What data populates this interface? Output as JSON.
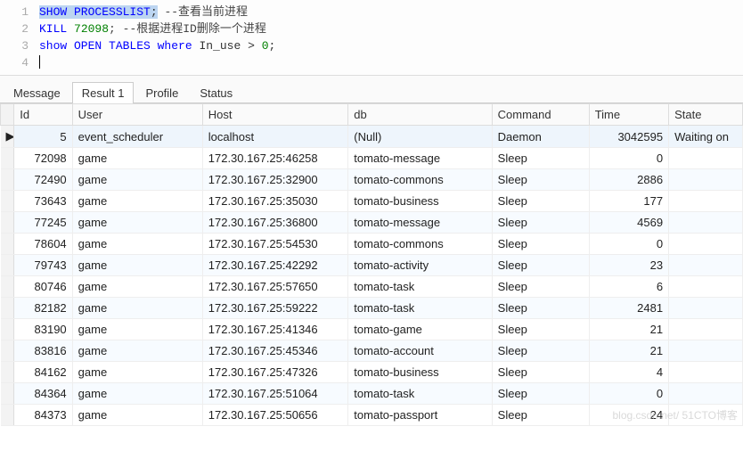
{
  "editor": {
    "lines": [
      {
        "n": "1",
        "tokens": [
          {
            "t": "SHOW PROCESSLIST",
            "cls": "kw sel"
          },
          {
            "t": ";",
            "cls": "sel"
          },
          {
            "t": " --查看当前进程",
            "cls": "comment"
          }
        ]
      },
      {
        "n": "2",
        "tokens": [
          {
            "t": "KILL",
            "cls": "kw"
          },
          {
            "t": " ",
            "cls": ""
          },
          {
            "t": "72098",
            "cls": "num"
          },
          {
            "t": "; --根据进程ID删除一个进程",
            "cls": "comment"
          }
        ]
      },
      {
        "n": "3",
        "tokens": [
          {
            "t": "show OPEN TABLES where",
            "cls": "kw"
          },
          {
            "t": " In_use ",
            "cls": ""
          },
          {
            "t": ">",
            "cls": ""
          },
          {
            "t": " ",
            "cls": ""
          },
          {
            "t": "0",
            "cls": "num"
          },
          {
            "t": ";",
            "cls": ""
          }
        ]
      },
      {
        "n": "4",
        "tokens": []
      }
    ]
  },
  "tabs": {
    "items": [
      {
        "label": "Message"
      },
      {
        "label": "Result 1",
        "active": true
      },
      {
        "label": "Profile"
      },
      {
        "label": "Status"
      }
    ]
  },
  "table": {
    "columns": [
      "Id",
      "User",
      "Host",
      "db",
      "Command",
      "Time",
      "State"
    ],
    "rows": [
      {
        "id": "5",
        "user": "event_scheduler",
        "host": "localhost",
        "db": "(Null)",
        "db_null": true,
        "command": "Daemon",
        "time": "3042595",
        "state": "Waiting on",
        "selected": true,
        "marker": "▶"
      },
      {
        "id": "72098",
        "user": "game",
        "host": "172.30.167.25:46258",
        "db": "tomato-message",
        "command": "Sleep",
        "time": "0",
        "state": ""
      },
      {
        "id": "72490",
        "user": "game",
        "host": "172.30.167.25:32900",
        "db": "tomato-commons",
        "command": "Sleep",
        "time": "2886",
        "state": ""
      },
      {
        "id": "73643",
        "user": "game",
        "host": "172.30.167.25:35030",
        "db": "tomato-business",
        "command": "Sleep",
        "time": "177",
        "state": ""
      },
      {
        "id": "77245",
        "user": "game",
        "host": "172.30.167.25:36800",
        "db": "tomato-message",
        "command": "Sleep",
        "time": "4569",
        "state": ""
      },
      {
        "id": "78604",
        "user": "game",
        "host": "172.30.167.25:54530",
        "db": "tomato-commons",
        "command": "Sleep",
        "time": "0",
        "state": ""
      },
      {
        "id": "79743",
        "user": "game",
        "host": "172.30.167.25:42292",
        "db": "tomato-activity",
        "command": "Sleep",
        "time": "23",
        "state": ""
      },
      {
        "id": "80746",
        "user": "game",
        "host": "172.30.167.25:57650",
        "db": "tomato-task",
        "command": "Sleep",
        "time": "6",
        "state": ""
      },
      {
        "id": "82182",
        "user": "game",
        "host": "172.30.167.25:59222",
        "db": "tomato-task",
        "command": "Sleep",
        "time": "2481",
        "state": ""
      },
      {
        "id": "83190",
        "user": "game",
        "host": "172.30.167.25:41346",
        "db": "tomato-game",
        "command": "Sleep",
        "time": "21",
        "state": ""
      },
      {
        "id": "83816",
        "user": "game",
        "host": "172.30.167.25:45346",
        "db": "tomato-account",
        "command": "Sleep",
        "time": "21",
        "state": ""
      },
      {
        "id": "84162",
        "user": "game",
        "host": "172.30.167.25:47326",
        "db": "tomato-business",
        "command": "Sleep",
        "time": "4",
        "state": ""
      },
      {
        "id": "84364",
        "user": "game",
        "host": "172.30.167.25:51064",
        "db": "tomato-task",
        "command": "Sleep",
        "time": "0",
        "state": ""
      },
      {
        "id": "84373",
        "user": "game",
        "host": "172.30.167.25:50656",
        "db": "tomato-passport",
        "command": "Sleep",
        "time": "24",
        "state": ""
      }
    ]
  },
  "watermark": "blog.csdn.net/ 51CTO博客"
}
